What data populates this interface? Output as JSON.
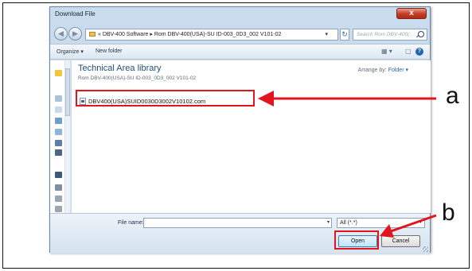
{
  "dialog": {
    "title": "Download File",
    "close_glyph": "x"
  },
  "address": {
    "path": "« DBV-400 Software ▸ Rom DBV-400(USA)-SU ID-003_0D3_002 V101-02",
    "dropdown_glyph": "▾",
    "refresh_glyph": "↻",
    "search_placeholder": "Search Rom DBV-400(..."
  },
  "nav": {
    "back_glyph": "◀",
    "forward_glyph": "▶"
  },
  "toolbar": {
    "organize_label": "Organize ▾",
    "new_folder_label": "New folder",
    "views_glyph": "▦ ▾",
    "preview_glyph": "▢",
    "help_glyph": "?"
  },
  "library": {
    "title": "Technical Area library",
    "subtitle": "Rom DBV-400(USA)-SU ID-003_0D3_002 V101-02",
    "arrange_label": "Arrange by:",
    "arrange_value": "Folder ▾"
  },
  "files": [
    {
      "name": "DBV400(USA)SUID0030D3002V10102.com"
    }
  ],
  "footer": {
    "file_name_label": "File name:",
    "file_name_value": "",
    "filter_value": "All (*.*)",
    "dropdown_glyph": "▾",
    "open_label": "Open",
    "cancel_label": "Cancel"
  },
  "callouts": {
    "a": "a",
    "b": "b"
  },
  "colors": {
    "highlight": "#e0151d",
    "link_blue": "#1f4e79"
  },
  "icons": {
    "close": "close-icon",
    "search": "search-icon",
    "help": "help-icon",
    "file": "file-icon"
  }
}
